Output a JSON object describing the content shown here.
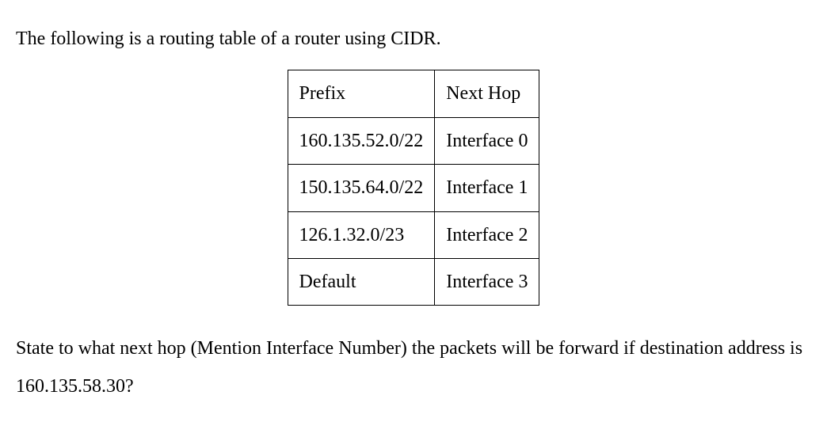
{
  "intro": "The following is a routing table of a router using CIDR.",
  "table": {
    "headers": {
      "col0": "Prefix",
      "col1": "Next Hop"
    },
    "rows": [
      {
        "prefix": "160.135.52.0/22",
        "nexthop": "Interface 0"
      },
      {
        "prefix": "150.135.64.0/22",
        "nexthop": "Interface 1"
      },
      {
        "prefix": "126.1.32.0/23",
        "nexthop": "Interface 2"
      },
      {
        "prefix": "Default",
        "nexthop": "Interface 3"
      }
    ]
  },
  "question": "State to what next hop (Mention Interface Number) the packets will be forward if destination address is 160.135.58.30?"
}
